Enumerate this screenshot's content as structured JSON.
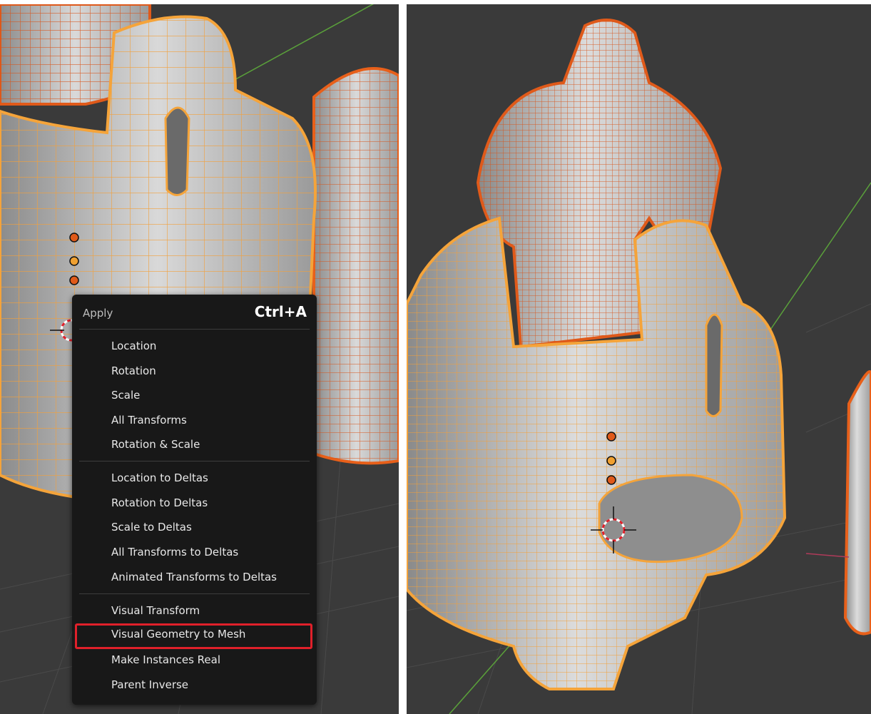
{
  "menu": {
    "title": "Apply",
    "shortcut": "Ctrl+A",
    "items": [
      {
        "label": "Location"
      },
      {
        "label": "Rotation"
      },
      {
        "label": "Scale"
      },
      {
        "label": "All Transforms"
      },
      {
        "label": "Rotation & Scale"
      },
      {
        "label": "Location to Deltas"
      },
      {
        "label": "Rotation to Deltas"
      },
      {
        "label": "Scale to Deltas"
      },
      {
        "label": "All Transforms to Deltas"
      },
      {
        "label": "Animated Transforms to Deltas"
      },
      {
        "label": "Visual Transform"
      },
      {
        "label": "Visual Geometry to Mesh"
      },
      {
        "label": "Make Instances Real"
      },
      {
        "label": "Parent Inverse"
      }
    ],
    "highlighted_item": "Visual Geometry to Mesh",
    "highlight_color": "#e0202a"
  },
  "colors": {
    "viewport_bg": "#3a3a3a",
    "wire_light": "#f5a43a",
    "wire_dark": "#e8601a",
    "origin_red": "#e05a1a",
    "origin_yellow": "#f0a030"
  },
  "icons": [
    "3d-cursor-icon",
    "object-origin-icon"
  ]
}
